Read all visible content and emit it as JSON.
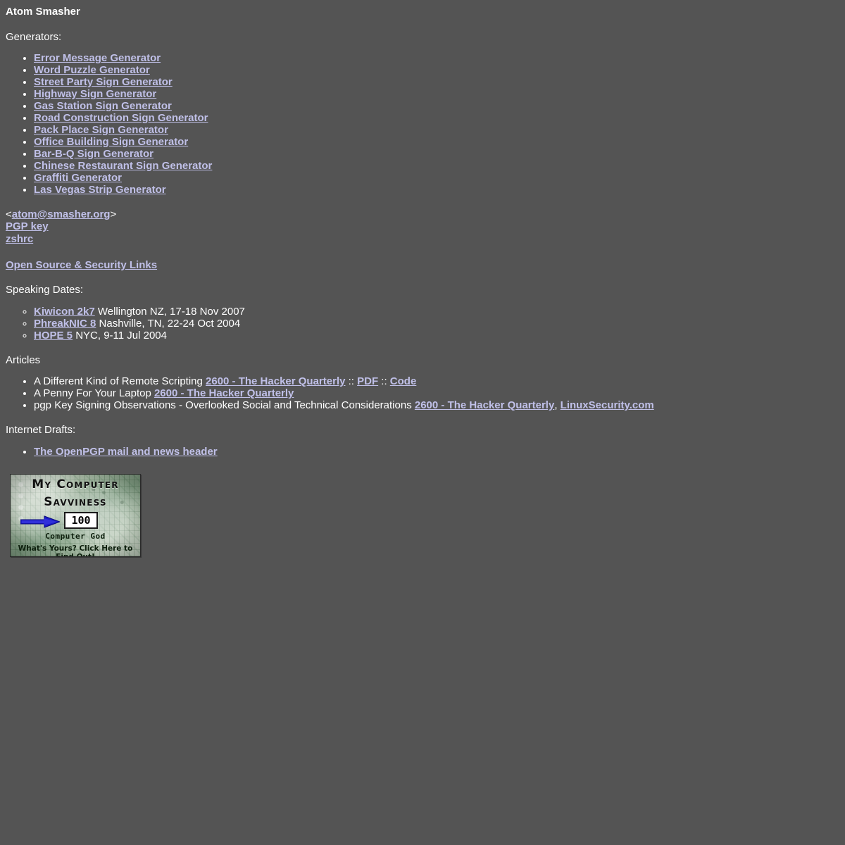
{
  "page": {
    "title": "Atom Smasher",
    "background_color": "#545454",
    "text_color": "#ffffff",
    "link_color": "#c0c0e8"
  },
  "generators": {
    "heading": "Generators:",
    "items": [
      "Error Message Generator",
      "Word Puzzle Generator",
      "Street Party Sign Generator",
      "Highway Sign Generator",
      "Gas Station Sign Generator",
      "Road Construction Sign Generator",
      "Pack Place Sign Generator",
      "Office Building Sign Generator",
      "Bar-B-Q Sign Generator",
      "Chinese Restaurant Sign Generator",
      "Graffiti Generator",
      "Las Vegas Strip Generator"
    ]
  },
  "contact": {
    "email_open_bracket": "<",
    "email": "atom@smasher.org",
    "email_close_bracket": ">",
    "pgp_key": "PGP key",
    "zshrc": "zshrc"
  },
  "open_source_links": {
    "label": "Open Source & Security Links"
  },
  "speaking": {
    "heading": "Speaking Dates:",
    "items": [
      {
        "link": "Kiwicon 2k7",
        "detail": " Wellington NZ, 17-18 Nov 2007"
      },
      {
        "link": "PhreakNIC 8",
        "detail": " Nashville, TN, 22-24 Oct 2004"
      },
      {
        "link": "HOPE 5",
        "detail": " NYC, 9-11 Jul 2004"
      }
    ]
  },
  "articles": {
    "heading": "Articles",
    "items": [
      {
        "title": "A Different Kind of Remote Scripting ",
        "links": [
          {
            "text": "2600 - The Hacker Quarterly"
          },
          {
            "text": "PDF"
          },
          {
            "text": "Code"
          }
        ],
        "separator": " :: "
      },
      {
        "title": "A Penny For Your Laptop ",
        "links": [
          {
            "text": "2600 - The Hacker Quarterly"
          }
        ],
        "separator": " :: "
      },
      {
        "title": "pgp Key Signing Observations - Overlooked Social and Technical Considerations ",
        "links": [
          {
            "text": "2600 - The Hacker Quarterly"
          },
          {
            "text": "LinuxSecurity.com"
          }
        ],
        "separator": ", "
      }
    ]
  },
  "internet_drafts": {
    "heading": "Internet Drafts:",
    "items": [
      "The OpenPGP mail and news header"
    ]
  },
  "banner": {
    "name": "my-computer-savviness-badge",
    "line1": "My Computer",
    "line2": "Savviness",
    "score": "100",
    "rank": "Computer God",
    "cta": "What's Yours? Click Here to Find Out!",
    "arrow_color": "#1b1bc8"
  }
}
